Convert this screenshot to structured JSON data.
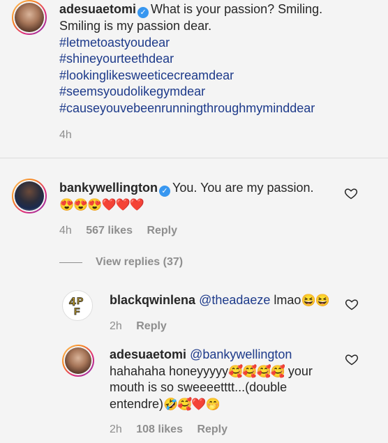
{
  "comment1": {
    "username": "adesuaetomi",
    "text_line1": "What is your passion? Smiling.",
    "text_line2": "Smiling is my passion dear.",
    "hashtags": [
      "#letmetoastyoudear",
      "#shineyourteethdear",
      "#lookinglikesweeticecreamdear",
      "#seemsyoudolikegymdear",
      "#causeyouvebeenrunningthroughmyminddear"
    ],
    "time": "4h"
  },
  "comment2": {
    "username": "bankywellington",
    "text": "You. You are my passion.",
    "emojis": "😍😍😍❤️❤️❤️",
    "time": "4h",
    "likes": "567 likes",
    "reply_label": "Reply"
  },
  "view_replies": "View replies (37)",
  "reply1": {
    "username": "blackqwinlena",
    "mention": "@theadaeze",
    "text": " lmao",
    "emojis": "😆😆",
    "time": "2h",
    "reply_label": "Reply",
    "avatar_letters": "4PF"
  },
  "reply2": {
    "username": "adesuaetomi",
    "mention": "@bankywellington",
    "line2_text": "hahahaha honeyyyyy",
    "line2_emojis": "🥰🥰🥰🥰",
    "line2_tail": " your",
    "line3": "mouth is so sweeeetttt...(double",
    "line4_text": "entendre)",
    "line4_emojis": "🤣🥰❤️🤭",
    "time": "2h",
    "likes": "108 likes",
    "reply_label": "Reply"
  },
  "colors": {
    "hashtag": "#1d3a8a",
    "verified": "#3897f0",
    "meta": "#8e8e8e"
  }
}
